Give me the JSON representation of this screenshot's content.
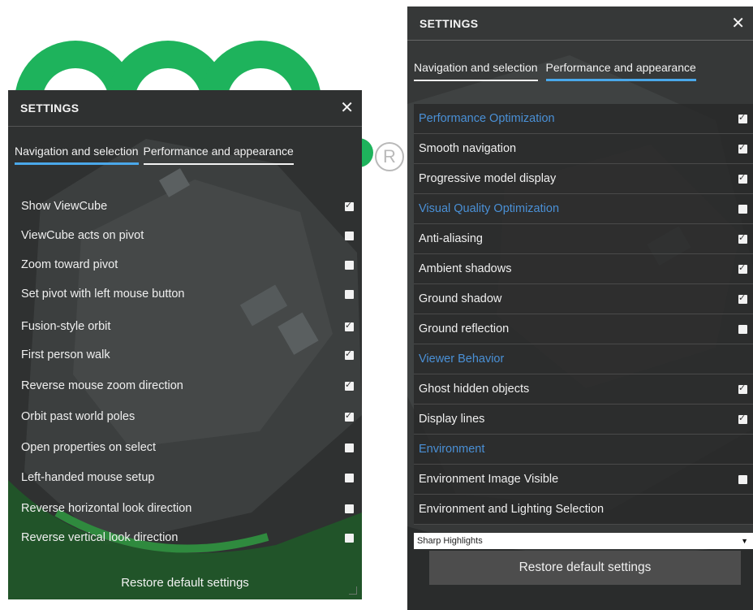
{
  "left_panel": {
    "title": "SETTINGS",
    "close_glyph": "✕",
    "tabs": [
      {
        "label": "Navigation and selection",
        "active": true
      },
      {
        "label": "Performance and appearance",
        "active": false
      }
    ],
    "options": [
      {
        "label": "Show ViewCube",
        "checked": true
      },
      {
        "label": "ViewCube acts on pivot",
        "checked": false
      },
      {
        "label": "Zoom toward pivot",
        "checked": false
      },
      {
        "label": "Set pivot with left mouse button",
        "checked": false
      },
      {
        "label": "Fusion-style orbit",
        "checked": true
      },
      {
        "label": "First person walk",
        "checked": true
      },
      {
        "label": "Reverse mouse zoom direction",
        "checked": true
      },
      {
        "label": "Orbit past world poles",
        "checked": true
      },
      {
        "label": "Open properties on select",
        "checked": false
      },
      {
        "label": "Left-handed mouse setup",
        "checked": false
      },
      {
        "label": "Reverse horizontal look direction",
        "checked": false
      },
      {
        "label": "Reverse vertical look direction",
        "checked": false
      }
    ],
    "restore_label": "Restore default settings"
  },
  "right_panel": {
    "title": "SETTINGS",
    "close_glyph": "✕",
    "tabs": [
      {
        "label": "Navigation and selection",
        "active": false
      },
      {
        "label": "Performance and appearance",
        "active": true
      }
    ],
    "rows": [
      {
        "label": "Performance Optimization",
        "section": true,
        "checked": true
      },
      {
        "label": "Smooth navigation",
        "section": false,
        "checked": true
      },
      {
        "label": "Progressive model display",
        "section": false,
        "checked": true
      },
      {
        "label": "Visual Quality Optimization",
        "section": true,
        "checked": false
      },
      {
        "label": "Anti-aliasing",
        "section": false,
        "checked": true
      },
      {
        "label": "Ambient shadows",
        "section": false,
        "checked": true
      },
      {
        "label": "Ground shadow",
        "section": false,
        "checked": true
      },
      {
        "label": "Ground reflection",
        "section": false,
        "checked": false
      },
      {
        "label": "Viewer Behavior",
        "section": true,
        "checked": null
      },
      {
        "label": "Ghost hidden objects",
        "section": false,
        "checked": true
      },
      {
        "label": "Display lines",
        "section": false,
        "checked": true
      },
      {
        "label": "Environment",
        "section": true,
        "checked": null
      },
      {
        "label": "Environment Image Visible",
        "section": false,
        "checked": false
      },
      {
        "label": "Environment and Lighting Selection",
        "section": false,
        "checked": null
      }
    ],
    "select_value": "Sharp Highlights",
    "restore_label": "Restore default settings"
  },
  "background": {
    "registered_mark": "R"
  },
  "colors": {
    "accent_blue": "#4aa8ea",
    "section_blue": "#4a90d6",
    "logo_green": "#1eb35c",
    "panel_dark": "#333636"
  }
}
